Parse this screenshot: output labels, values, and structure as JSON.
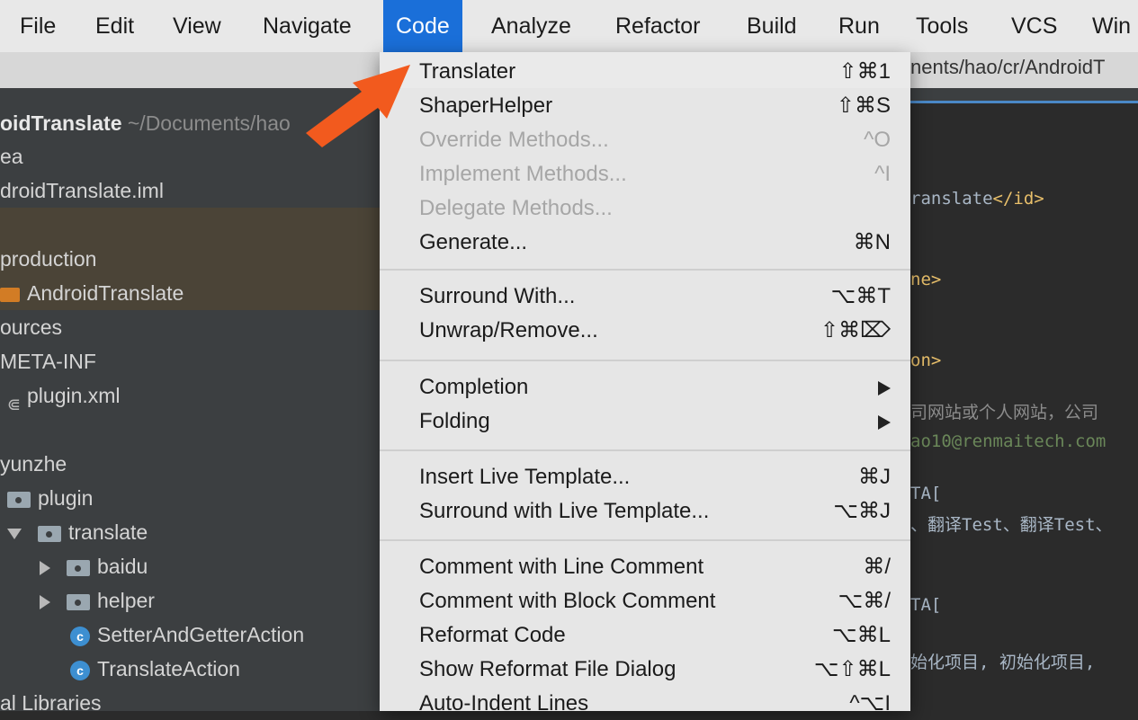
{
  "menubar": {
    "items": [
      "File",
      "Edit",
      "View",
      "Navigate",
      "Code",
      "Analyze",
      "Refactor",
      "Build",
      "Run",
      "Tools",
      "VCS",
      "Win"
    ],
    "active": "Code"
  },
  "toolbar": {
    "path": "nents/hao/cr/AndroidT"
  },
  "tree": {
    "rows": [
      {
        "text": "oidTranslate",
        "hint": " ~/Documents/hao"
      },
      {
        "text": "ea"
      },
      {
        "text": "droidTranslate.iml"
      },
      {
        "text": ""
      },
      {
        "text": "production"
      },
      {
        "text": "AndroidTranslate"
      },
      {
        "text": "ources"
      },
      {
        "text": "META-INF"
      },
      {
        "text": "plugin.xml"
      },
      {
        "text": ""
      },
      {
        "text": "yunzhe"
      },
      {
        "text": "plugin"
      },
      {
        "text": "translate"
      },
      {
        "text": "baidu"
      },
      {
        "text": "helper"
      },
      {
        "text": "SetterAndGetterAction"
      },
      {
        "text": "TranslateAction"
      },
      {
        "text": "al Libraries"
      }
    ]
  },
  "editor": {
    "lines": [
      {
        "pre": "ranslate",
        "tag": "</id>"
      },
      {
        "tag": "ne>"
      },
      {
        "tag": "on>"
      },
      {
        "plain": "司网站或个人网站，公司"
      },
      {
        "str": "ao10@renmaitech.com"
      },
      {
        "plain": "TA["
      },
      {
        "plain": "、翻译Test、翻译Test、"
      },
      {
        "plain": "TA["
      },
      {
        "plain": "始化项目, 初始化项目,"
      }
    ]
  },
  "menu": {
    "items": [
      {
        "label": "Translater",
        "shortcut": "⇧⌘1",
        "disabled": false
      },
      {
        "label": "ShaperHelper",
        "shortcut": "⇧⌘S",
        "disabled": false
      },
      {
        "label": "Override Methods...",
        "shortcut": "^O",
        "disabled": true
      },
      {
        "label": "Implement Methods...",
        "shortcut": "^I",
        "disabled": true
      },
      {
        "label": "Delegate Methods...",
        "shortcut": "",
        "disabled": true
      },
      {
        "label": "Generate...",
        "shortcut": "⌘N",
        "disabled": false
      },
      {
        "label": "Surround With...",
        "shortcut": "⌥⌘T",
        "disabled": false
      },
      {
        "label": "Unwrap/Remove...",
        "shortcut": "⇧⌘⌦",
        "disabled": false
      },
      {
        "label": "Completion",
        "shortcut": "",
        "submenu": true,
        "disabled": false
      },
      {
        "label": "Folding",
        "shortcut": "",
        "submenu": true,
        "disabled": false
      },
      {
        "label": "Insert Live Template...",
        "shortcut": "⌘J",
        "disabled": false
      },
      {
        "label": "Surround with Live Template...",
        "shortcut": "⌥⌘J",
        "disabled": false
      },
      {
        "label": "Comment with Line Comment",
        "shortcut": "⌘/",
        "disabled": false
      },
      {
        "label": "Comment with Block Comment",
        "shortcut": "⌥⌘/",
        "disabled": false
      },
      {
        "label": "Reformat Code",
        "shortcut": "⌥⌘L",
        "disabled": false
      },
      {
        "label": "Show Reformat File Dialog",
        "shortcut": "⌥⇧⌘L",
        "disabled": false
      },
      {
        "label": "Auto-Indent Lines",
        "shortcut": "^⌥I",
        "disabled": false
      }
    ]
  },
  "colors": {
    "accent": "#1a6fd9",
    "annotation_arrow": "#f25a1e",
    "folder": "#d27c25"
  }
}
